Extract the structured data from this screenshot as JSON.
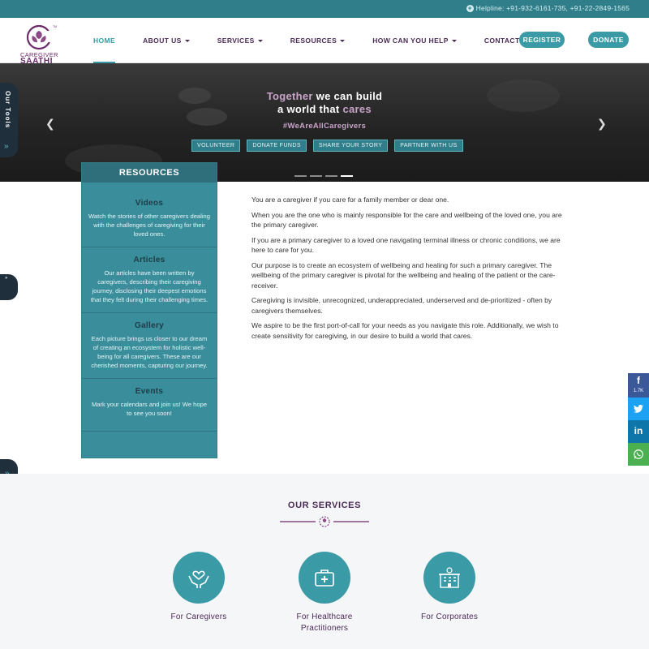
{
  "topbar": {
    "helpline": "Helpline: +91-932-6161-735, +91-22-2849-1565"
  },
  "brand": {
    "line1": "CAREGIVER",
    "line2": "SAATHI",
    "tm": "TM"
  },
  "nav": {
    "items": [
      {
        "label": "HOME",
        "has_caret": false,
        "active": true
      },
      {
        "label": "ABOUT US",
        "has_caret": true,
        "active": false
      },
      {
        "label": "SERVICES",
        "has_caret": true,
        "active": false
      },
      {
        "label": "RESOURCES",
        "has_caret": true,
        "active": false
      },
      {
        "label": "HOW CAN YOU HELP",
        "has_caret": true,
        "active": false
      },
      {
        "label": "CONTACT US",
        "has_caret": false,
        "active": false
      }
    ],
    "register": "REGISTER",
    "donate": "DONATE"
  },
  "hero": {
    "line1_highlight": "Together",
    "line1_rest": " we can build",
    "line2_start": "a world that ",
    "line2_highlight": "cares",
    "hashtag": "#WeAreAllCaregivers",
    "buttons": [
      "VOLUNTEER",
      "DONATE FUNDS",
      "SHARE YOUR STORY",
      "PARTNER WITH US"
    ],
    "slides": 4,
    "active_slide": 4
  },
  "tools_tab": {
    "label": "Our Tools"
  },
  "resources": {
    "title": "RESOURCES",
    "sections": [
      {
        "title": "Videos",
        "text": "Watch the stories of other caregivers dealing with the challenges of caregiving for their loved ones."
      },
      {
        "title": "Articles",
        "text": "Our articles have been written by caregivers, describing their caregiving journey, disclosing their deepest emotions that they felt during their challenging times."
      },
      {
        "title": "Gallery",
        "text": "Each picture brings us closer to our dream of creating an ecosystem for holistic well-being for all caregivers. These are our cherished moments, capturing our journey."
      },
      {
        "title": "Events",
        "text": "Mark your calendars and join us! We hope to see you soon!"
      }
    ]
  },
  "content": {
    "paragraphs": [
      "You are a caregiver if you care for a family member or dear one.",
      "When you are the one who is mainly responsible for the care and wellbeing of the loved one, you are the primary caregiver.",
      "If you are a primary caregiver to a loved one navigating terminal illness or chronic conditions, we are here to care for you.",
      "Our purpose is to create an ecosystem of wellbeing and healing for such a primary caregiver. The wellbeing of the primary caregiver is pivotal for the wellbeing and healing of the patient or the care-receiver.",
      "Caregiving is invisible, unrecognized, underappreciated, underserved and de-prioritized - often by caregivers themselves.",
      "We aspire to be the first port-of-call for your needs as you navigate this role. Additionally, we wish to create sensitivity for caregiving, in our desire to build a world that cares."
    ]
  },
  "social": {
    "facebook_count": "1.7K",
    "colors": {
      "facebook": "#3b5998",
      "twitter": "#1da1f2",
      "linkedin": "#0e76a8",
      "whatsapp": "#4caf50"
    }
  },
  "services": {
    "title": "OUR SERVICES",
    "items": [
      {
        "label": "For Caregivers",
        "icon": "hands-heart-icon"
      },
      {
        "label": "For Healthcare Practitioners",
        "icon": "medical-kit-icon"
      },
      {
        "label": "For Corporates",
        "icon": "building-icon"
      }
    ]
  },
  "colors": {
    "teal": "#3a9aa5",
    "dark_teal": "#2f7e8a",
    "purple": "#4a2a56",
    "hero_highlight": "#c9a3c9"
  }
}
